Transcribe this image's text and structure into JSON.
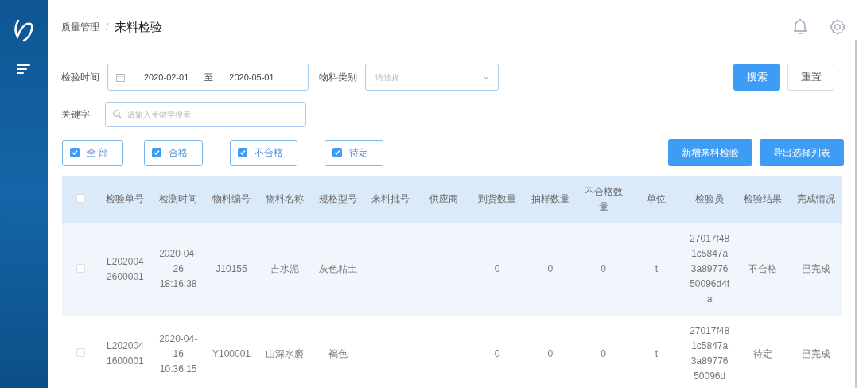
{
  "breadcrumb": {
    "parent": "质量管理",
    "separator": "/",
    "current": "来料检验"
  },
  "filters": {
    "date_label": "检验时间",
    "date_from": "2020-02-01",
    "date_to_word": "至",
    "date_to": "2020-05-01",
    "category_label": "物料类别",
    "category_placeholder": "请选择",
    "keyword_label": "关键字",
    "keyword_placeholder": "请输入关键字搜索"
  },
  "actions": [
    {
      "label": "搜索",
      "kind": "primary"
    },
    {
      "label": "重置",
      "kind": "plain"
    }
  ],
  "status_filters": [
    {
      "label": "全 部",
      "checked": true
    },
    {
      "label": "合格",
      "checked": true
    },
    {
      "label": "不合格",
      "checked": true
    },
    {
      "label": "待定",
      "checked": true
    }
  ],
  "table_actions": [
    "新增来料检验",
    "导出选择列表"
  ],
  "table": {
    "select_all_checked": false,
    "columns": [
      "检验单号",
      "检测时间",
      "物料编号",
      "物料名称",
      "规格型号",
      "来料批号",
      "供应商",
      "到货数量",
      "抽样数量",
      "不合格数量",
      "单位",
      "检验员",
      "检验结果",
      "完成情况"
    ],
    "rows": [
      {
        "checked": false,
        "cells": [
          "L2020042600001",
          "2020-04-26 18:16:38",
          "J10155",
          "吉水泥",
          "灰色粘土",
          "",
          "",
          "0",
          "0",
          "0",
          "t",
          "27017f481c5847a3a8977650096d4fa",
          "不合格",
          "已完成"
        ]
      },
      {
        "checked": false,
        "cells": [
          "L2020041600001",
          "2020-04-16 10:36:15",
          "Y100001",
          "山深水磨",
          "褐色",
          "",
          "",
          "0",
          "0",
          "0",
          "t",
          "27017f481c5847a3a8977650096d",
          "待定",
          "已完成"
        ]
      }
    ]
  }
}
